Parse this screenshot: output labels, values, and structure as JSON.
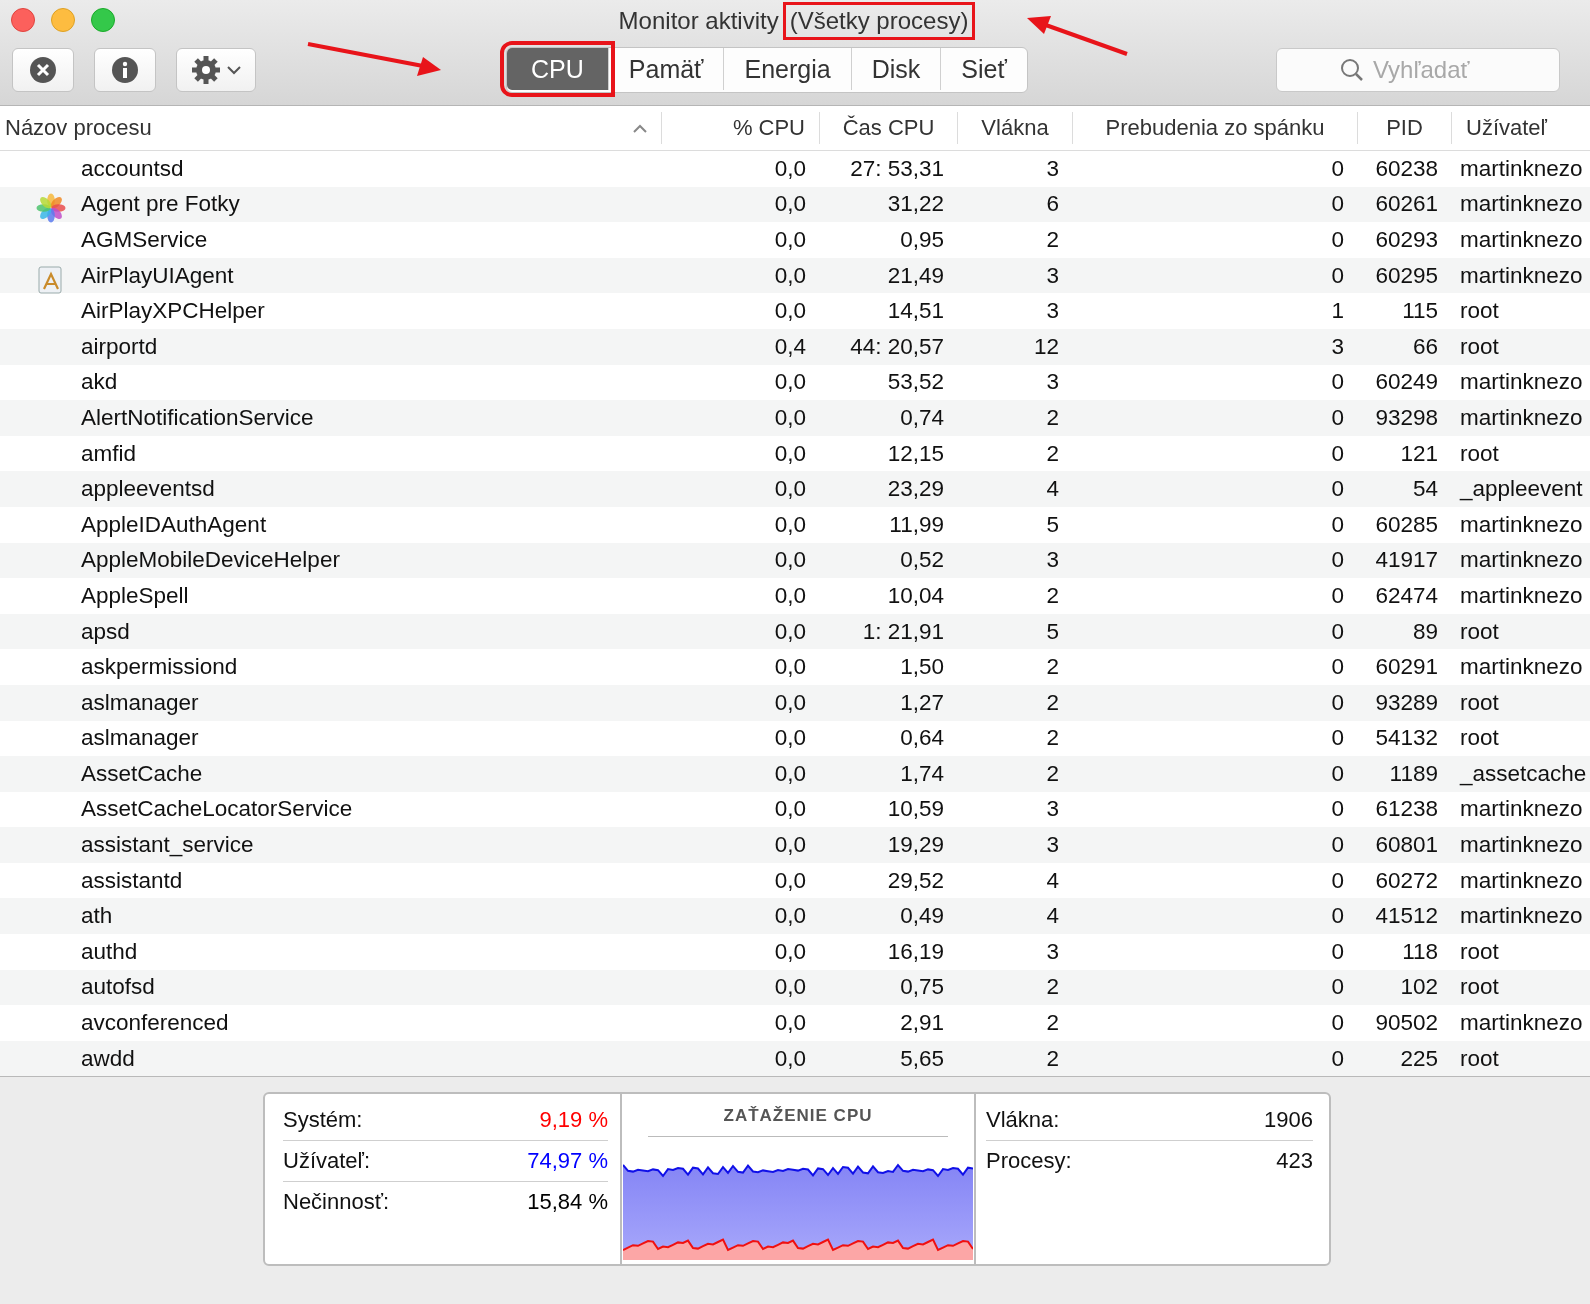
{
  "window": {
    "title": "Monitor aktivity",
    "title_filter": "(Všetky procesy)"
  },
  "toolbar": {
    "tabs": [
      {
        "label": "CPU",
        "selected": true
      },
      {
        "label": "Pamäť",
        "selected": false
      },
      {
        "label": "Energia",
        "selected": false
      },
      {
        "label": "Disk",
        "selected": false
      },
      {
        "label": "Sieť",
        "selected": false
      }
    ],
    "search": {
      "placeholder": "Vyhľadať"
    }
  },
  "table": {
    "columns": [
      {
        "label": "Názov procesu",
        "sorted": true
      },
      {
        "label": "% CPU",
        "sorted": false
      },
      {
        "label": "Čas CPU",
        "sorted": false
      },
      {
        "label": "Vlákna",
        "sorted": false
      },
      {
        "label": "Prebudenia zo spánku",
        "sorted": false
      },
      {
        "label": "PID",
        "sorted": false
      },
      {
        "label": "Užívateľ",
        "sorted": false
      }
    ],
    "rows": [
      {
        "name": "accountsd",
        "cpu": "0,0",
        "cpu_time": "27: 53,31",
        "threads": "3",
        "wakeups": "0",
        "pid": "60238",
        "user": "martinknezo"
      },
      {
        "name": "Agent pre Fotky",
        "kind": "flower",
        "cpu": "0,0",
        "cpu_time": "31,22",
        "threads": "6",
        "wakeups": "0",
        "pid": "60261",
        "user": "martinknezo"
      },
      {
        "name": "AGMService",
        "cpu": "0,0",
        "cpu_time": "0,95",
        "threads": "2",
        "wakeups": "0",
        "pid": "60293",
        "user": "martinknezo"
      },
      {
        "name": "AirPlayUIAgent",
        "kind": "app",
        "cpu": "0,0",
        "cpu_time": "21,49",
        "threads": "3",
        "wakeups": "0",
        "pid": "60295",
        "user": "martinknezo"
      },
      {
        "name": "AirPlayXPCHelper",
        "cpu": "0,0",
        "cpu_time": "14,51",
        "threads": "3",
        "wakeups": "1",
        "pid": "115",
        "user": "root"
      },
      {
        "name": "airportd",
        "cpu": "0,4",
        "cpu_time": "44: 20,57",
        "threads": "12",
        "wakeups": "3",
        "pid": "66",
        "user": "root"
      },
      {
        "name": "akd",
        "cpu": "0,0",
        "cpu_time": "53,52",
        "threads": "3",
        "wakeups": "0",
        "pid": "60249",
        "user": "martinknezo"
      },
      {
        "name": "AlertNotificationService",
        "cpu": "0,0",
        "cpu_time": "0,74",
        "threads": "2",
        "wakeups": "0",
        "pid": "93298",
        "user": "martinknezo"
      },
      {
        "name": "amfid",
        "cpu": "0,0",
        "cpu_time": "12,15",
        "threads": "2",
        "wakeups": "0",
        "pid": "121",
        "user": "root"
      },
      {
        "name": "appleeventsd",
        "cpu": "0,0",
        "cpu_time": "23,29",
        "threads": "4",
        "wakeups": "0",
        "pid": "54",
        "user": "_appleevent"
      },
      {
        "name": "AppleIDAuthAgent",
        "cpu": "0,0",
        "cpu_time": "11,99",
        "threads": "5",
        "wakeups": "0",
        "pid": "60285",
        "user": "martinknezo"
      },
      {
        "name": "AppleMobileDeviceHelper",
        "cpu": "0,0",
        "cpu_time": "0,52",
        "threads": "3",
        "wakeups": "0",
        "pid": "41917",
        "user": "martinknezo"
      },
      {
        "name": "AppleSpell",
        "cpu": "0,0",
        "cpu_time": "10,04",
        "threads": "2",
        "wakeups": "0",
        "pid": "62474",
        "user": "martinknezo"
      },
      {
        "name": "apsd",
        "cpu": "0,0",
        "cpu_time": "1: 21,91",
        "threads": "5",
        "wakeups": "0",
        "pid": "89",
        "user": "root"
      },
      {
        "name": "askpermissiond",
        "cpu": "0,0",
        "cpu_time": "1,50",
        "threads": "2",
        "wakeups": "0",
        "pid": "60291",
        "user": "martinknezo"
      },
      {
        "name": "aslmanager",
        "cpu": "0,0",
        "cpu_time": "1,27",
        "threads": "2",
        "wakeups": "0",
        "pid": "93289",
        "user": "root"
      },
      {
        "name": "aslmanager",
        "cpu": "0,0",
        "cpu_time": "0,64",
        "threads": "2",
        "wakeups": "0",
        "pid": "54132",
        "user": "root"
      },
      {
        "name": "AssetCache",
        "cpu": "0,0",
        "cpu_time": "1,74",
        "threads": "2",
        "wakeups": "0",
        "pid": "1189",
        "user": "_assetcache"
      },
      {
        "name": "AssetCacheLocatorService",
        "cpu": "0,0",
        "cpu_time": "10,59",
        "threads": "3",
        "wakeups": "0",
        "pid": "61238",
        "user": "martinknezo"
      },
      {
        "name": "assistant_service",
        "cpu": "0,0",
        "cpu_time": "19,29",
        "threads": "3",
        "wakeups": "0",
        "pid": "60801",
        "user": "martinknezo"
      },
      {
        "name": "assistantd",
        "cpu": "0,0",
        "cpu_time": "29,52",
        "threads": "4",
        "wakeups": "0",
        "pid": "60272",
        "user": "martinknezo"
      },
      {
        "name": "ath",
        "cpu": "0,0",
        "cpu_time": "0,49",
        "threads": "4",
        "wakeups": "0",
        "pid": "41512",
        "user": "martinknezo"
      },
      {
        "name": "authd",
        "cpu": "0,0",
        "cpu_time": "16,19",
        "threads": "3",
        "wakeups": "0",
        "pid": "118",
        "user": "root"
      },
      {
        "name": "autofsd",
        "cpu": "0,0",
        "cpu_time": "0,75",
        "threads": "2",
        "wakeups": "0",
        "pid": "102",
        "user": "root"
      },
      {
        "name": "avconferenced",
        "cpu": "0,0",
        "cpu_time": "2,91",
        "threads": "2",
        "wakeups": "0",
        "pid": "90502",
        "user": "martinknezo"
      },
      {
        "name": "awdd",
        "cpu": "0,0",
        "cpu_time": "5,65",
        "threads": "2",
        "wakeups": "0",
        "pid": "225",
        "user": "root"
      }
    ]
  },
  "summary": {
    "left": [
      {
        "label": "Systém:",
        "value": "9,19 %",
        "color": "#ff0000"
      },
      {
        "label": "Užívateľ:",
        "value": "74,97 %",
        "color": "#0000ff"
      },
      {
        "label": "Nečinnosť:",
        "value": "15,84 %",
        "color": "#000000"
      }
    ],
    "chart_title": "ZAŤAŽENIE CPU",
    "right": [
      {
        "label": "Vlákna:",
        "value": "1906"
      },
      {
        "label": "Procesy:",
        "value": "423"
      }
    ]
  }
}
